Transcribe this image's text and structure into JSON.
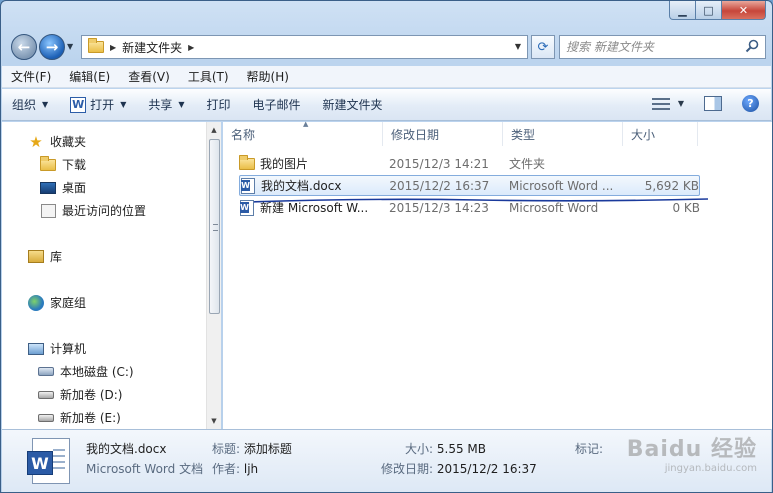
{
  "nav": {
    "breadcrumb": [
      "新建文件夹"
    ],
    "search_placeholder": "搜索 新建文件夹"
  },
  "menu": [
    "文件(F)",
    "编辑(E)",
    "查看(V)",
    "工具(T)",
    "帮助(H)"
  ],
  "toolbar": {
    "organize": "组织",
    "open": "打开",
    "share": "共享",
    "print": "打印",
    "email": "电子邮件",
    "new_folder": "新建文件夹"
  },
  "sidebar": {
    "favorites": "收藏夹",
    "downloads": "下载",
    "desktop": "桌面",
    "recent": "最近访问的位置",
    "libraries": "库",
    "homegroup": "家庭组",
    "computer": "计算机",
    "drive_c": "本地磁盘 (C:)",
    "drive_d": "新加卷 (D:)",
    "drive_e": "新加卷 (E:)"
  },
  "columns": {
    "name": "名称",
    "date": "修改日期",
    "type": "类型",
    "size": "大小"
  },
  "files": [
    {
      "name": "我的图片",
      "date": "2015/12/3 14:21",
      "type": "文件夹",
      "size": "",
      "icon": "folder-icon"
    },
    {
      "name": "我的文档.docx",
      "date": "2015/12/2 16:37",
      "type": "Microsoft Word ...",
      "size": "5,692 KB",
      "icon": "word-doc-icon"
    },
    {
      "name": "新建 Microsoft W...",
      "date": "2015/12/3 14:23",
      "type": "Microsoft Word",
      "size": "0 KB",
      "icon": "word-doc-icon"
    }
  ],
  "details": {
    "filename": "我的文档.docx",
    "filetype": "Microsoft Word 文档",
    "title_label": "标题:",
    "title_value": "添加标题",
    "author_label": "作者:",
    "author_value": "ljh",
    "size_label": "大小:",
    "size_value": "5.55 MB",
    "modified_label": "修改日期:",
    "modified_value": "2015/12/2 16:37",
    "tag_label": "标记:"
  },
  "watermark": {
    "line1": "Baidu 经验",
    "line2": "jingyan.baidu.com"
  },
  "colors": {
    "selection_border": "#84acdd",
    "annotation_stroke": "#1a3a9c"
  }
}
